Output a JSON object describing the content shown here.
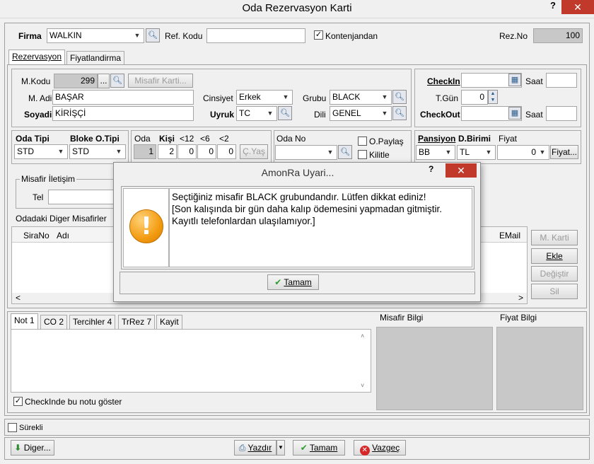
{
  "window": {
    "title": "Oda Rezervasyon Karti",
    "help": "?",
    "close": "✕"
  },
  "top": {
    "firma_label": "Firma",
    "firma_value": "WALKIN",
    "ref_label": "Ref. Kodu",
    "ref_value": "",
    "kontenjan_label": "Kontenjandan",
    "kontenjan_checked": "✓",
    "rezno_label": "Rez.No",
    "rezno_value": "100"
  },
  "tabs": {
    "rezervasyon": "Rezervasyon",
    "fiyatlandirma": "Fiyatlandirma"
  },
  "guest": {
    "mkodu_label": "M.Kodu",
    "mkodu_value": "299",
    "dots": "...",
    "misafir_karti": "Misafir Karti...",
    "madi_label": "M. Adi",
    "madi_value": "BAŞAR",
    "soyadi_label": "Soyadi",
    "soyadi_value": "KİRİŞÇİ",
    "cinsiyet_label": "Cinsiyet",
    "cinsiyet_value": "Erkek",
    "uyruk_label": "Uyruk",
    "uyruk_value": "TC",
    "grubu_label": "Grubu",
    "grubu_value": "BLACK",
    "dili_label": "Dili",
    "dili_value": "GENEL"
  },
  "dates": {
    "checkin_label": "CheckIn",
    "saat1_label": "Saat",
    "tgun_label": "T.Gün",
    "tgun_value": "0",
    "checkout_label": "CheckOut",
    "saat2_label": "Saat"
  },
  "room": {
    "odatipi_label": "Oda Tipi",
    "odatipi_value": "STD",
    "bloke_label": "Bloke O.Tipi",
    "bloke_value": "STD",
    "oda_label": "Oda",
    "kisi_label": "Kişi",
    "lt12_label": "<12",
    "lt6_label": "<6",
    "lt2_label": "<2",
    "oda_value": "1",
    "kisi_value": "2",
    "lt12_value": "0",
    "lt6_value": "0",
    "lt2_value": "0",
    "cyas": "Ç.Yaş",
    "odano_label": "Oda No",
    "opaylas_label": "O.Paylaş",
    "kilitle_label": "Kilitle",
    "pansiyon_label": "Pansiyon",
    "dbirimi_label": "D.Birimi",
    "fiyat_label": "Fiyat",
    "pansiyon_value": "BB",
    "dbirimi_value": "TL",
    "fiyat_value": "0",
    "fiyat_btn": "Fiyat..."
  },
  "contact": {
    "title": "Misafir İletişim",
    "tel_label": "Tel"
  },
  "others": {
    "title": "Odadaki Diger Misafirler",
    "col_sirano": "SiraNo",
    "col_adi": "Adı",
    "col_email": "EMail",
    "mkarti": "M. Karti",
    "ekle": "Ekle",
    "degistir": "Değiştir",
    "sil": "Sil"
  },
  "notes": {
    "tab_not": "Not 1",
    "tab_co": "CO 2",
    "tab_tercihler": "Tercihler 4",
    "tab_trrez": "TrRez 7",
    "tab_kayit": "Kayit",
    "checkin_note": "CheckInde bu notu göster",
    "misafir_bilgi": "Misafir Bilgi",
    "fiyat_bilgi": "Fiyat Bilgi"
  },
  "bottom": {
    "surekli": "Sürekli",
    "diger": "Diger...",
    "yazdir": "Yazdır",
    "tamam": "Tamam",
    "vazgec": "Vazgeç"
  },
  "dialog": {
    "title": "AmonRa Uyari...",
    "help": "?",
    "close": "✕",
    "line1": "Seçtiğiniz misafir BLACK grubundandır. Lütfen dikkat ediniz!",
    "line2": "[Son kalışında bir gün daha kalıp ödemesini yapmadan gitmiştir.",
    "line3": "Kayıtlı telefonlardan ulaşılamıyor.]",
    "ok": "Tamam"
  },
  "colors": {
    "accent_close": "#c0392b",
    "gray_field": "#c8c8c8",
    "warning_icon": "#f39c12"
  }
}
